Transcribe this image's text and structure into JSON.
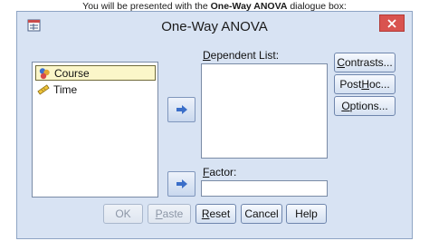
{
  "caption": {
    "prefix": "You will be presented with the ",
    "bold": "One-Way ANOVA",
    "suffix": " dialogue box:"
  },
  "dialog": {
    "title": "One-Way ANOVA",
    "variables": [
      {
        "label": "Course",
        "icon": "nominal-variable-icon",
        "selected": true
      },
      {
        "label": "Time",
        "icon": "scale-variable-icon",
        "selected": false
      }
    ],
    "dependent_list_label_parts": [
      "",
      "D",
      "ependent List:"
    ],
    "factor_label_parts": [
      "",
      "F",
      "actor:"
    ],
    "side_buttons": [
      {
        "parts": [
          "",
          "C",
          "ontrasts..."
        ]
      },
      {
        "parts": [
          "Post ",
          "H",
          "oc..."
        ]
      },
      {
        "parts": [
          "",
          "O",
          "ptions..."
        ]
      }
    ],
    "bottom_buttons": [
      {
        "parts": [
          "OK",
          "",
          ""
        ],
        "enabled": false
      },
      {
        "parts": [
          "",
          "P",
          "aste"
        ],
        "enabled": false
      },
      {
        "parts": [
          "",
          "R",
          "eset"
        ],
        "enabled": true
      },
      {
        "parts": [
          "Cancel",
          "",
          ""
        ],
        "enabled": true
      },
      {
        "parts": [
          "Help",
          "",
          ""
        ],
        "enabled": true
      }
    ]
  },
  "colors": {
    "dialog_bg": "#d8e3f3",
    "close_button": "#d9534f",
    "selected_item": "#fbf6c9",
    "arrow": "#3b6fc9"
  }
}
